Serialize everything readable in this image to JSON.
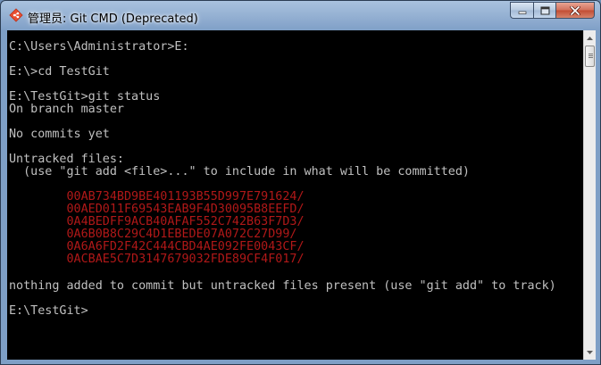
{
  "window": {
    "title": "管理员: Git CMD (Deprecated)",
    "app_icon": "git-diamond-icon",
    "controls": [
      "minimize-icon",
      "maximize-icon",
      "close-icon"
    ]
  },
  "colors": {
    "console_bg": "#000000",
    "console_text": "#c0c0c0",
    "untracked_text": "#b01818"
  },
  "console": {
    "lines": [
      "C:\\Users\\Administrator>E:",
      "",
      "E:\\>cd TestGit",
      "",
      "E:\\TestGit>git status",
      "On branch master",
      "",
      "No commits yet",
      "",
      "Untracked files:",
      "  (use \"git add <file>...\" to include in what will be committed)",
      "",
      "        00AB734BD9BE401193B55D997E791624/",
      "        00AED011F69543EAB9F4D30095B8EEFD/",
      "        0A4BEDFF9ACB40AFAF552C742B63F7D3/",
      "        0A6B0B8C29C4D1EBEDE07A072C27D99/",
      "        0A6A6FD2F42C444CBD4AE092FE0043CF/",
      "        0ACBAE5C7D3147679032FDE89CF4F017/",
      "",
      "nothing added to commit but untracked files present (use \"git add\" to track)",
      "",
      "E:\\TestGit>"
    ]
  }
}
